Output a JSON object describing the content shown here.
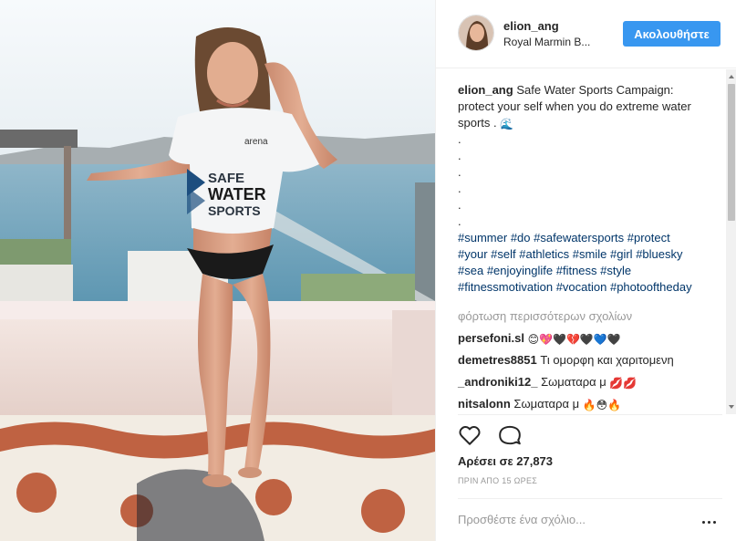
{
  "post": {
    "username": "elion_ang",
    "location": "Royal Marmin B...",
    "follow_label": "Ακολουθήστε",
    "shirt_text_line1": "SAFE",
    "shirt_text_line2": "WATER",
    "shirt_text_line3": "SPORTS",
    "shirt_brand": "arena"
  },
  "caption": {
    "username": "elion_ang",
    "text": "Safe Water Sports Campaign: protect your self when you do extreme water sports .",
    "emoji": "🌊",
    "dots": [
      ".",
      ".",
      ".",
      ".",
      ".",
      "."
    ],
    "hashtags": [
      "#summer",
      "#do",
      "#safewatersports",
      "#protect",
      "#your",
      "#self",
      "#athletics",
      "#smile",
      "#girl",
      "#bluesky",
      "#sea",
      "#enjoyinglife",
      "#fitness",
      "#style",
      "#fitnessmotivation",
      "#vocation",
      "#photooftheday"
    ]
  },
  "load_more_label": "φόρτωση περισσότερων σχολίων",
  "comments": [
    {
      "username": "persefoni.sl",
      "text": "",
      "emoji": "😊💖🖤💔🖤💙🖤"
    },
    {
      "username": "demetres8851",
      "text": "Τι ομορφη και χαριτομενη",
      "emoji": ""
    },
    {
      "username": "_androniki12_",
      "text": "Σωματαρα μ",
      "emoji": "💋💋"
    },
    {
      "username": "nitsalonn",
      "text": "Σωματαρα μ",
      "emoji": "🔥😳🔥"
    }
  ],
  "likes_label": "Αρέσει σε 27,873",
  "time_ago": "ΠΡΙΝ ΑΠΟ 15 ΩΡΕΣ",
  "add_comment_placeholder": "Προσθέστε ένα σχόλιο...",
  "icons": {
    "like": "heart-outline-icon",
    "comment": "speech-bubble-icon",
    "more": "ellipsis-icon"
  },
  "colors": {
    "accent": "#3897f0",
    "hashtag": "#003569",
    "muted": "#999999"
  }
}
